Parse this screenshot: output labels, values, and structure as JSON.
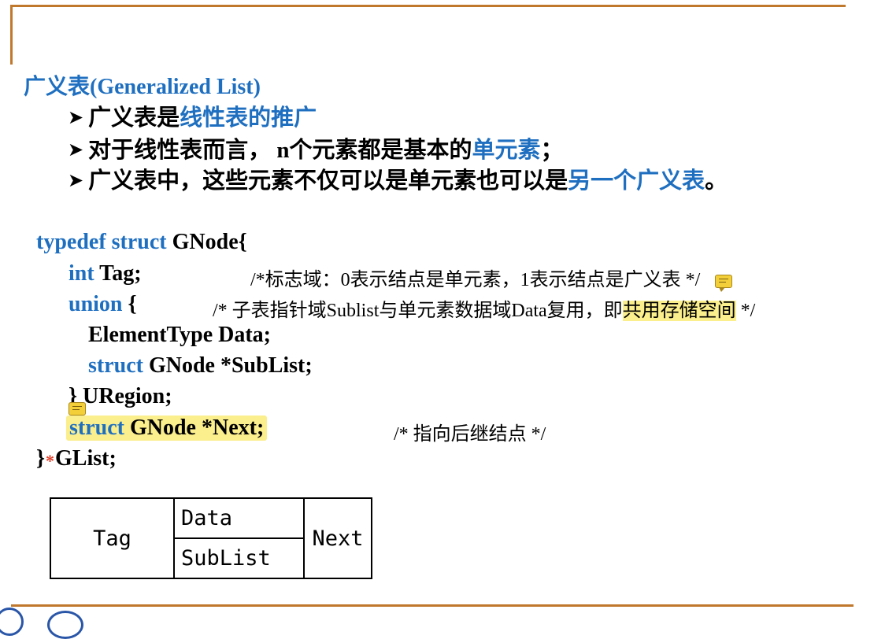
{
  "title": "广义表(Generalized List)",
  "bullets": [
    {
      "arrow": "➤",
      "text": "广义表是",
      "highlight": "线性表的推广",
      "tail": ""
    },
    {
      "arrow": "➤",
      "text": "对于线性表而言，",
      "n": " n",
      "text2": "个元素都是基本的",
      "highlight": "单元素",
      "tail": "；"
    },
    {
      "arrow": "➤",
      "text": "广义表中，这些元素不仅可以是单元素也可以是",
      "highlight": "另一个广义表",
      "tail": "。"
    }
  ],
  "code": {
    "line1_kw": "typedef struct",
    "line1_rest": " GNode{",
    "line2_kw": "int",
    "line2_rest": " Tag;",
    "line2_comment": "/*标志域：0表示结点是单元素，1表示结点是广义表 */",
    "line3_kw": "union",
    "line3_rest": " {",
    "line3_comment": "/* 子表指针域Sublist与单元素数据域Data复用，即",
    "line3_comment_hl": "共用存储空间",
    "line3_comment_tail": " */",
    "line4": "ElementType    Data;",
    "line5_kw": "struct",
    "line5_rest": " GNode *SubList;",
    "line6": "} URegion;",
    "line7_kw": "struct",
    "line7_rest": " GNode *Next;",
    "line7_comment": "/* 指向后继结点 */",
    "line8": "}",
    "line8_rest": "GList;",
    "asterisk": "*"
  },
  "table": {
    "tag": "Tag",
    "data": "Data",
    "sublist": "SubList",
    "next": "Next"
  },
  "colors": {
    "accent_blue": "#1f6fc0",
    "rule": "#c0782c",
    "highlight": "#fbee8d"
  }
}
